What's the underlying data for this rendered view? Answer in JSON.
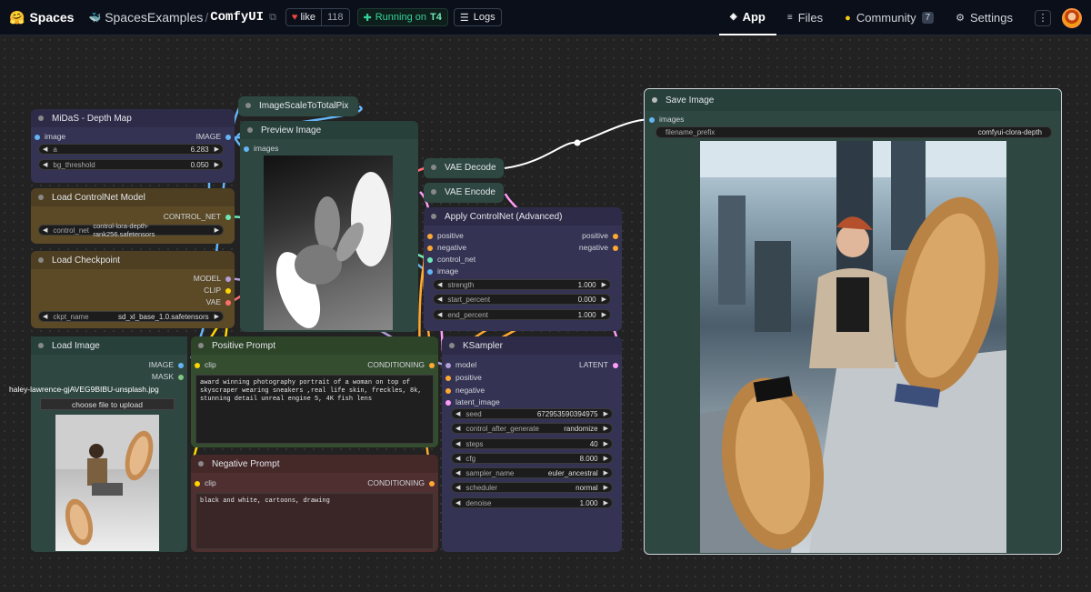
{
  "topbar": {
    "brand": "Spaces",
    "org": "SpacesExamples",
    "space_name": "ComfyUI",
    "like_label": "like",
    "like_count": "118",
    "status_label": "Running on",
    "status_hardware": "T4",
    "logs_label": "Logs",
    "tabs": [
      {
        "label": "App",
        "active": true,
        "icon": "cube-icon"
      },
      {
        "label": "Files",
        "icon": "files-icon"
      },
      {
        "label": "Community",
        "badge": "7",
        "icon": "community-icon"
      },
      {
        "label": "Settings",
        "icon": "gear-icon"
      }
    ]
  },
  "nodes": {
    "midas": {
      "title": "MiDaS - Depth Map",
      "input": "image",
      "output": "IMAGE",
      "widgets": [
        {
          "label": "a",
          "value": "6.283"
        },
        {
          "label": "bg_threshold",
          "value": "0.050"
        }
      ]
    },
    "scale": {
      "title": "ImageScaleToTotalPix"
    },
    "preview": {
      "title": "Preview Image",
      "input": "images"
    },
    "controlnet_loader": {
      "title": "Load ControlNet Model",
      "output": "CONTROL_NET",
      "widget": {
        "label": "control_net_name",
        "value": "control-lora-depth-rank256.safetensors"
      }
    },
    "checkpoint": {
      "title": "Load Checkpoint",
      "outputs": [
        "MODEL",
        "CLIP",
        "VAE"
      ],
      "widget": {
        "label": "ckpt_name",
        "value": "sd_xl_base_1.0.safetensors"
      }
    },
    "vae_decode": {
      "title": "VAE Decode"
    },
    "vae_encode": {
      "title": "VAE Encode"
    },
    "apply_cn": {
      "title": "Apply ControlNet (Advanced)",
      "inputs": [
        "positive",
        "negative",
        "control_net",
        "image"
      ],
      "outputs": [
        "positive",
        "negative"
      ],
      "widgets": [
        {
          "label": "strength",
          "value": "1.000"
        },
        {
          "label": "start_percent",
          "value": "0.000"
        },
        {
          "label": "end_percent",
          "value": "1.000"
        }
      ]
    },
    "load_image": {
      "title": "Load Image",
      "outputs": [
        "IMAGE",
        "MASK"
      ],
      "filename": "haley-lawrence-gjAVEG9BIBU-unsplash.jpg",
      "upload_label": "choose file to upload"
    },
    "positive": {
      "title": "Positive Prompt",
      "input": "clip",
      "output": "CONDITIONING",
      "text": "award winning photography portrait of a woman on top of skyscraper wearing sneakers ,real life skin, freckles, 8k, stunning detail unreal engine 5, 4K fish lens"
    },
    "negative": {
      "title": "Negative Prompt",
      "input": "clip",
      "output": "CONDITIONING",
      "text": "black and white, cartoons, drawing"
    },
    "ksampler": {
      "title": "KSampler",
      "inputs": [
        "model",
        "positive",
        "negative",
        "latent_image"
      ],
      "output": "LATENT",
      "widgets": [
        {
          "label": "seed",
          "value": "672953590394975"
        },
        {
          "label": "control_after_generate",
          "value": "randomize"
        },
        {
          "label": "steps",
          "value": "40"
        },
        {
          "label": "cfg",
          "value": "8.000"
        },
        {
          "label": "sampler_name",
          "value": "euler_ancestral"
        },
        {
          "label": "scheduler",
          "value": "normal"
        },
        {
          "label": "denoise",
          "value": "1.000"
        }
      ]
    },
    "save": {
      "title": "Save Image",
      "input": "images",
      "widget": {
        "label": "filename_prefix",
        "value": "comfyui-clora-depth"
      }
    }
  },
  "colors": {
    "slot_image": "#64b5f6",
    "slot_clip": "#ffd500",
    "slot_vae": "#ff6e6e",
    "slot_model": "#b39ddb",
    "slot_conditioning": "#ffa931",
    "slot_latent": "#ff9cf9",
    "slot_controlnet": "#6ee7b7"
  }
}
